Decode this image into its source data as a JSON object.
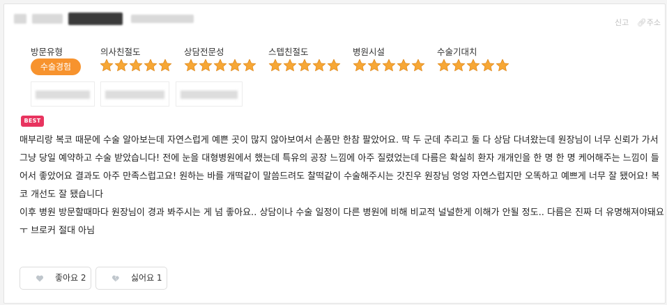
{
  "header": {
    "report_label": "신고",
    "address_label": "주소",
    "link_icon": "link-icon"
  },
  "categories": [
    {
      "label": "방문유형"
    },
    {
      "label": "의사친절도",
      "rating": 5
    },
    {
      "label": "상담전문성",
      "rating": 5
    },
    {
      "label": "스텝친절도",
      "rating": 5
    },
    {
      "label": "병원시설",
      "rating": 5
    },
    {
      "label": "수술기대치",
      "rating": 5
    }
  ],
  "visit_type": "수술경험",
  "best_badge": "BEST",
  "review": {
    "paragraph1": "매부리랑 복코 때문에 수술 알아보는데 자연스럽게 예쁜 곳이 많지 않아보여서 손품만 한참 팔았어요. 딱 두 군데 추리고 둘 다 상담 다녀왔는데 원장님이 너무 신뢰가 가서 그냥 당일 예약하고 수술 받았습니다! 전에 눈을 대형병원에서 했는데 특유의 공장 느낌에 아주 질렸었는데 다름은 확실히 환자 개개인을 한 명 한 명 케어해주는 느낌이 들어서 좋았어요 결과도 아주 만족스럽고요! 원하는 바를 개떡같이 말씀드려도 찰떡같이 수술해주시는 갓진우 원장님 엉엉 자연스럽지만 오똑하고 예쁘게 너무 잘 됐어요! 복코 개선도 잘 됐습니다",
    "paragraph2": "이후 병원 방문할때마다 원장님이 경과 봐주시는 게 넘 좋아요.. 상담이나 수술 일정이 다른 병원에 비해 비교적 널널한게 이해가 안될 정도.. 다름은 진짜 더 유명해져야돼요ㅜ 브로커 절대 아님"
  },
  "votes": {
    "like_label": "좋아요 2",
    "dislike_label": "싫어요 1"
  },
  "colors": {
    "accent": "#f7932e",
    "best": "#e8345f",
    "star": "#f7a735"
  }
}
